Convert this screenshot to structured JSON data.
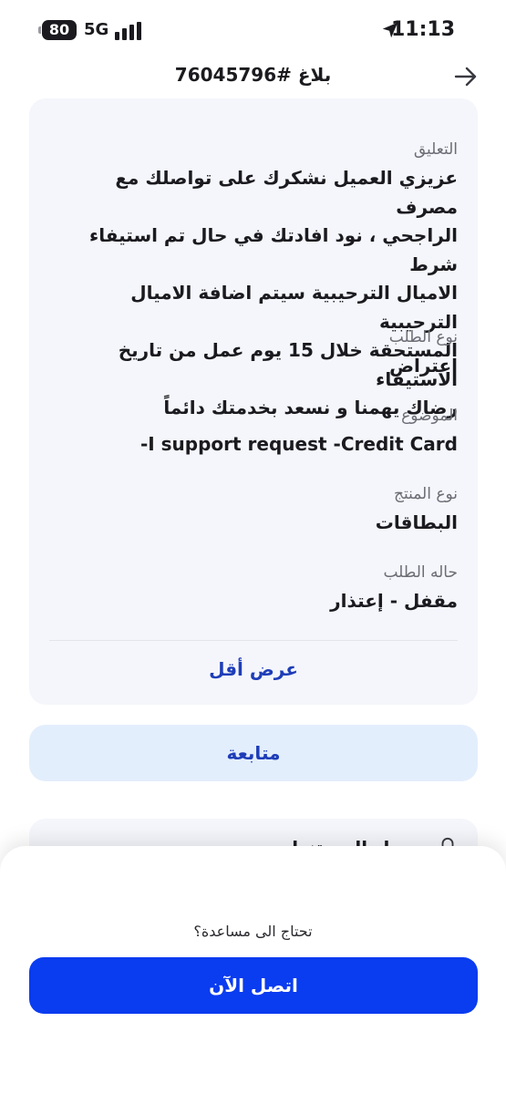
{
  "status_bar": {
    "battery": "80",
    "network": "5G",
    "time": "11:13"
  },
  "header": {
    "title": "بلاغ #76045796"
  },
  "details": {
    "comment_label": "التعليق",
    "comment_lines": [
      "عزيزي العميل نشكرك على تواصلك مع مصرف",
      "الراجحي ، نود افادتك في حال تم استيفاء شرط",
      "الاميال الترحيبية سيتم اضافة الاميال الترحيبية",
      "المستحقة خلال 15 يوم عمل من تاريخ الاستيفاء",
      "رضاك يهمنا و نسعد بخدمتك دائماً"
    ],
    "request_type_label": "نوع الطلب",
    "request_type_value": "اعتراض",
    "subject_label": "الموضوع",
    "subject_value": "I support request -Credit Card-",
    "product_type_label": "نوع المنتج",
    "product_type_value": "البطاقات",
    "status_label": "حاله الطلب",
    "status_value": "مقفل - إعتذار",
    "show_less": "عرض أقل"
  },
  "follow_up": {
    "label": "متابعة"
  },
  "next_card": {
    "label": "سجل المستندات"
  },
  "bottom_sheet": {
    "help_text": "تحتاج الى مساعدة؟",
    "call_label": "اتصل الآن"
  },
  "colors": {
    "accent": "#1e3db8",
    "primary_button": "#0a3cf0",
    "card_bg": "#f4f6fb",
    "follow_bg": "#e3eefc"
  }
}
